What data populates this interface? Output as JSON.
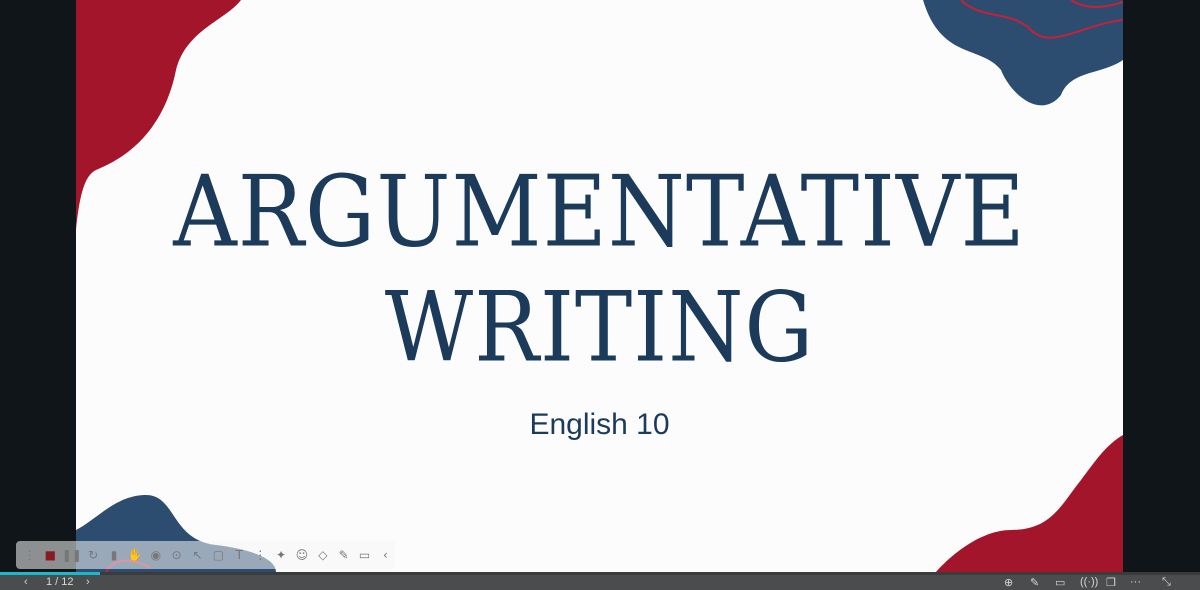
{
  "slide": {
    "title_line1": "ARGUMENTATIVE",
    "title_line2": "WRITING",
    "subtitle": "English 10"
  },
  "colors": {
    "navy": "#1c3a5a",
    "crimson": "#a3152a",
    "blob_blue": "#2c4d70",
    "progress": "#1ab8c8"
  },
  "toolbar": {
    "icons": [
      "drag-handle-icon",
      "stop-icon",
      "pause-icon",
      "restart-icon",
      "delete-icon",
      "cursor-icon",
      "pen-icon",
      "highlighter-icon",
      "laser-icon",
      "shape-icon",
      "text-icon",
      "select-icon",
      "magic-icon",
      "emoji-icon",
      "eraser-icon",
      "mic-icon",
      "camera-icon",
      "collapse-icon"
    ]
  },
  "bottom_bar": {
    "prev": "‹",
    "page_indicator": "1 / 12",
    "next": "›",
    "progress_fraction": 0.083,
    "more": "···"
  }
}
